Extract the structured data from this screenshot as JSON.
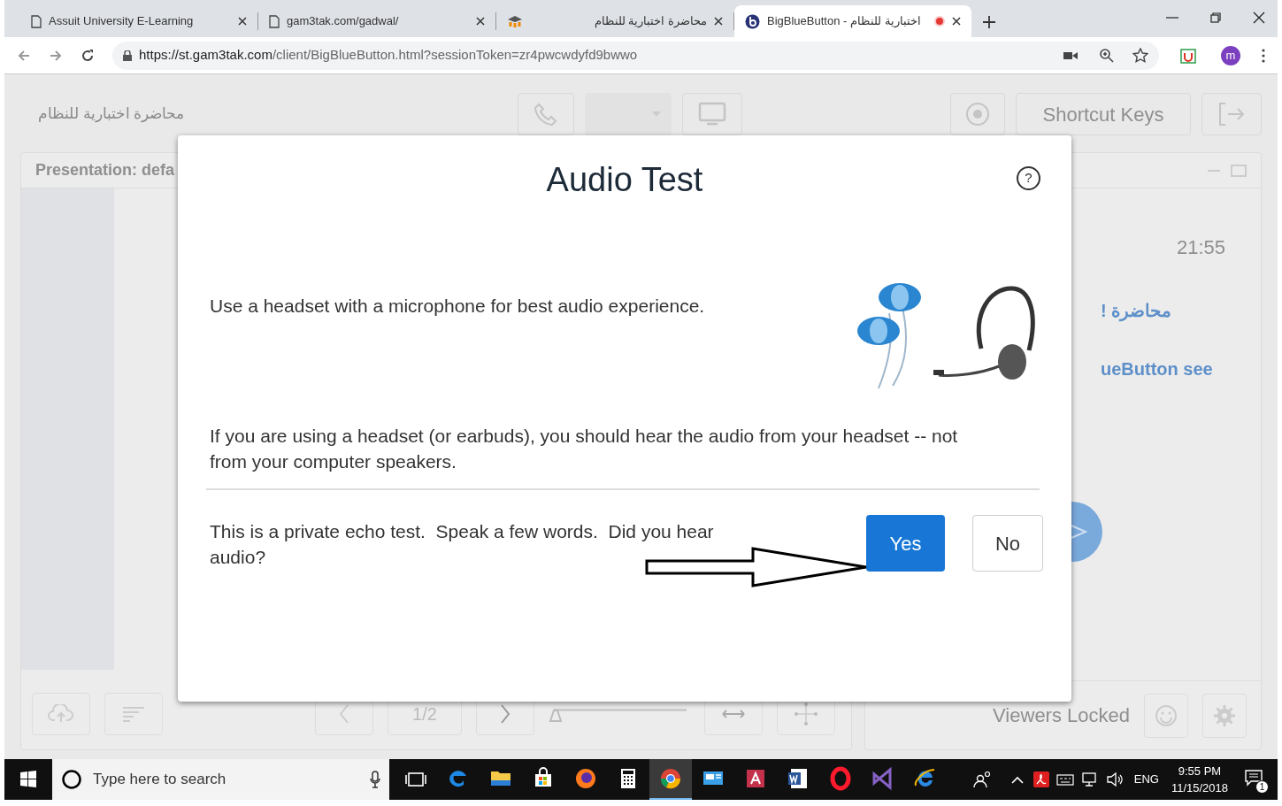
{
  "browser": {
    "tabs": [
      {
        "title": "Assuit University E-Learning",
        "kind": "page",
        "selected": false
      },
      {
        "title": "gam3tak.com/gadwal/",
        "kind": "page",
        "selected": false
      },
      {
        "title": "محاضرة اختبارية للنظام",
        "kind": "moodle",
        "selected": false
      },
      {
        "title": "BigBlueButton - اختبارية للنظام",
        "kind": "bbb",
        "selected": true
      }
    ],
    "url_host": "https://st.gam3tak.com",
    "url_path": "/client/BigBlueButton.html?sessionToken=zr4pwcwdyfd9bwwo",
    "profile": "m"
  },
  "app": {
    "title": "محاضرة اختبارية للنظام",
    "shortcut_keys": "Shortcut Keys",
    "presentation": {
      "title": "Presentation: defa",
      "page": "1/2",
      "zoom": {
        "level": 0
      }
    },
    "chat": {
      "time": "21:55",
      "messages": [
        "! محاضرة",
        "ueButton see"
      ]
    },
    "users": {
      "status": "Viewers Locked"
    }
  },
  "dialog": {
    "title": "Audio Test",
    "help": "?",
    "paragraphs": [
      "Use a headset with a microphone for best audio experience.",
      "If you are using a headset (or earbuds), you should hear the audio from your headset -- not from your computer speakers."
    ],
    "question": "This is a private echo test.  Speak a few words.  Did you hear audio?",
    "buttons": [
      {
        "label": "Yes",
        "primary": true
      },
      {
        "label": "No",
        "primary": false
      }
    ]
  },
  "taskbar": {
    "search_placeholder": "Type here to search",
    "apps": [
      {
        "kind": "edge",
        "selected": false
      },
      {
        "kind": "explorer",
        "selected": false
      },
      {
        "kind": "store",
        "selected": false
      },
      {
        "kind": "firefox",
        "selected": false
      },
      {
        "kind": "calculator",
        "selected": false
      },
      {
        "kind": "chrome",
        "selected": true
      },
      {
        "kind": "monitor",
        "selected": false
      },
      {
        "kind": "access",
        "selected": false
      },
      {
        "kind": "word",
        "selected": false
      },
      {
        "kind": "opera",
        "selected": false
      },
      {
        "kind": "visualstudio",
        "selected": false
      },
      {
        "kind": "ie",
        "selected": false
      }
    ],
    "language": "ENG",
    "time": "9:55 PM",
    "date": "11/15/2018",
    "notifications": "1"
  }
}
